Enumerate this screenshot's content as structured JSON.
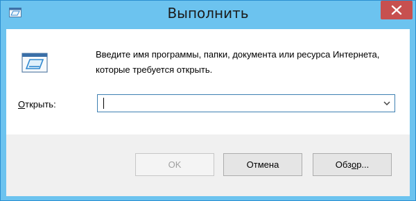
{
  "window": {
    "title": "Выполнить"
  },
  "dialog": {
    "description": "Введите имя программы, папки, документа или ресурса Интернета, которые требуется открыть.",
    "open_label_accel": "О",
    "open_label_rest": "ткрыть:",
    "input_value": ""
  },
  "buttons": {
    "ok_label": "OK",
    "cancel_label": "Отмена",
    "browse_label_pre": "Обз",
    "browse_label_accel": "о",
    "browse_label_post": "р..."
  },
  "colors": {
    "frame": "#6cc3ef",
    "client_bg": "#f0f0f0",
    "close_button": "#c7504f"
  },
  "icons": {
    "title_icon": "run-icon",
    "main_icon": "run-icon",
    "close": "close-icon",
    "combo_arrow": "chevron-down-icon"
  }
}
